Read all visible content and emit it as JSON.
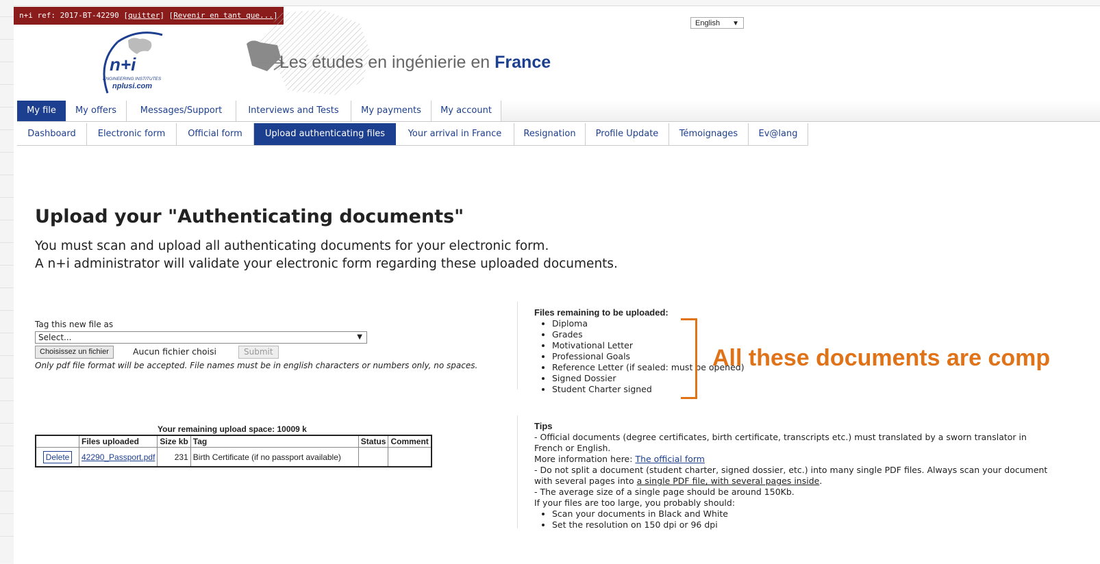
{
  "refbar": {
    "ref": "n+i ref: 2017-BT-42290",
    "quit": "quitter",
    "return_as": "Revenir en tant que..."
  },
  "logo": {
    "name": "n+i",
    "sub1": "ENGINEERING INSTITUTES",
    "sub2": "nplusi.com"
  },
  "banner": {
    "text": "Les études en ingénierie en",
    "bold": "France"
  },
  "language": {
    "selected": "English"
  },
  "nav_primary": [
    "My file",
    "My offers",
    "Messages/Support",
    "Interviews and Tests",
    "My payments",
    "My account"
  ],
  "nav_secondary": [
    "Dashboard",
    "Electronic form",
    "Official form",
    "Upload authenticating files",
    "Your arrival in France",
    "Resignation",
    "Profile Update",
    "Témoignages",
    "Ev@lang"
  ],
  "page": {
    "title": "Upload your \"Authenticating documents\"",
    "intro1": "You must scan and upload all authenticating documents for your electronic form.",
    "intro2": "A n+i administrator will validate your electronic form regarding these uploaded documents."
  },
  "upload": {
    "tag_label": "Tag this new file as",
    "select_value": "Select...",
    "choose_button": "Choisissez un fichier",
    "no_file": "Aucun fichier choisi",
    "submit": "Submit",
    "note": "Only pdf file format will be accepted. File names must be in english characters or numbers only, no spaces."
  },
  "files": {
    "remaining_space": "Your remaining upload space: 10009 k",
    "headers": [
      "",
      "Files uploaded",
      "Size kb",
      "Tag",
      "Status",
      "Comment"
    ],
    "rows": [
      {
        "action": "Delete",
        "file": "42290_Passport.pdf",
        "size": "231",
        "tag": "Birth Certificate (if no passport available)",
        "status": "",
        "comment": ""
      }
    ]
  },
  "remaining": {
    "header": "Files remaining to be uploaded:",
    "items": [
      "Diploma",
      "Grades",
      "Motivational Letter",
      "Professional Goals",
      "Reference Letter (if sealed: must be opened)",
      "Signed Dossier",
      "Student Charter signed"
    ]
  },
  "callout": {
    "text": "All these documents are comp"
  },
  "tips": {
    "header": "Tips",
    "l1": "- Official documents (degree certificates, birth certificate, transcripts etc.) must translated by a sworn translator in French or English.",
    "l2_prefix": "More information here: ",
    "l2_link": "The official form",
    "l3_prefix": "- Do not split a document (student charter, signed dossier, etc.) into many single PDF files. Always scan your document with several pages into ",
    "l3_link": "a single PDF file, with several pages inside",
    "l3_suffix": ".",
    "l4": "- The average size of a single page should be around 150Kb.",
    "l5": "If your files are too large, you probably should:",
    "bullets": [
      "Scan your documents in Black and White",
      "Set the resolution on 150 dpi or 96 dpi"
    ]
  },
  "colors": {
    "nav_active": "#1d3f8f",
    "refbar": "#8b1c1c",
    "callout": "#e07318"
  }
}
